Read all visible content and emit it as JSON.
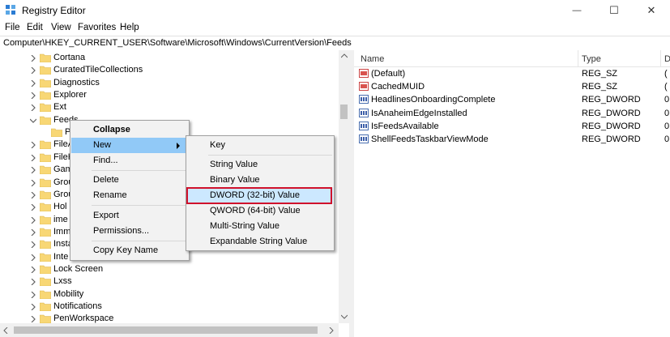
{
  "window": {
    "title": "Registry Editor",
    "minimize_glyph": "—",
    "maximize_glyph": "☐",
    "close_glyph": "✕"
  },
  "menubar": {
    "file": "File",
    "edit": "Edit",
    "view": "View",
    "favorites": "Favorites",
    "help": "Help"
  },
  "address": {
    "path": "Computer\\HKEY_CURRENT_USER\\Software\\Microsoft\\Windows\\CurrentVersion\\Feeds"
  },
  "tree": {
    "items": [
      {
        "label": "Cortana",
        "expanded": false
      },
      {
        "label": "CuratedTileCollections",
        "expanded": false
      },
      {
        "label": "Diagnostics",
        "expanded": false
      },
      {
        "label": "Explorer",
        "expanded": false
      },
      {
        "label": "Ext",
        "expanded": false
      },
      {
        "label": "Feeds",
        "expanded": true
      },
      {
        "label": "P",
        "expanded": false
      },
      {
        "label": "FileA",
        "expanded": false
      },
      {
        "label": "FileH",
        "expanded": false
      },
      {
        "label": "Gam",
        "expanded": false
      },
      {
        "label": "Grou",
        "expanded": false
      },
      {
        "label": "Grou",
        "expanded": false
      },
      {
        "label": "Hol",
        "expanded": false
      },
      {
        "label": "ime",
        "expanded": false
      },
      {
        "label": "Imm",
        "expanded": false
      },
      {
        "label": "Insta",
        "expanded": false
      },
      {
        "label": "Inte",
        "expanded": false
      },
      {
        "label": "Lock Screen",
        "expanded": false
      },
      {
        "label": "Lxss",
        "expanded": false
      },
      {
        "label": "Mobility",
        "expanded": false
      },
      {
        "label": "Notifications",
        "expanded": false
      },
      {
        "label": "PenWorkspace",
        "expanded": false
      }
    ]
  },
  "list": {
    "columns": {
      "name": "Name",
      "type": "Type",
      "data": "D"
    },
    "rows": [
      {
        "name": "(Default)",
        "type": "REG_SZ",
        "data": "(",
        "icon": "string-value-icon"
      },
      {
        "name": "CachedMUID",
        "type": "REG_SZ",
        "data": "(",
        "icon": "string-value-icon"
      },
      {
        "name": "HeadlinesOnboardingComplete",
        "type": "REG_DWORD",
        "data": "0",
        "icon": "binary-value-icon"
      },
      {
        "name": "IsAnaheimEdgeInstalled",
        "type": "REG_DWORD",
        "data": "0",
        "icon": "binary-value-icon"
      },
      {
        "name": "IsFeedsAvailable",
        "type": "REG_DWORD",
        "data": "0",
        "icon": "binary-value-icon"
      },
      {
        "name": "ShellFeedsTaskbarViewMode",
        "type": "REG_DWORD",
        "data": "0",
        "icon": "binary-value-icon"
      }
    ]
  },
  "context_menu": {
    "collapse": "Collapse",
    "new": "New",
    "find": "Find...",
    "delete": "Delete",
    "rename": "Rename",
    "export": "Export",
    "permissions": "Permissions...",
    "copy_key_name": "Copy Key Name"
  },
  "submenu": {
    "key": "Key",
    "string_value": "String Value",
    "binary_value": "Binary Value",
    "dword_value": "DWORD (32-bit) Value",
    "qword_value": "QWORD (64-bit) Value",
    "multi_string_value": "Multi-String Value",
    "expandable_string_value": "Expandable String Value"
  },
  "colors": {
    "highlight": "#cce8ff",
    "highlight_border": "#99d1ff",
    "callout": "#d0112b",
    "folder": "#f8d775"
  }
}
